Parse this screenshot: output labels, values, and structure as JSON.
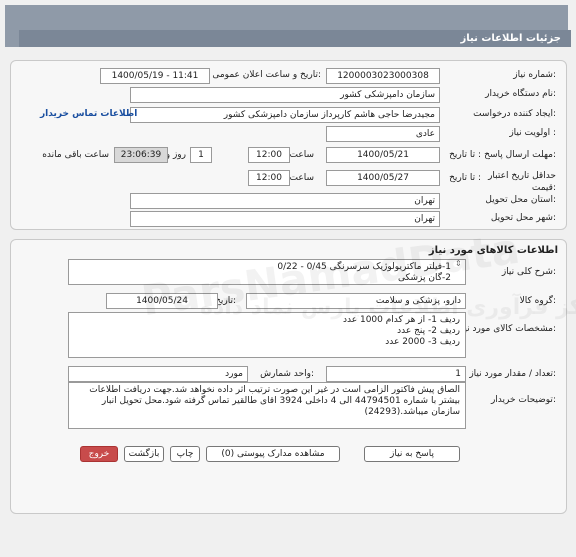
{
  "page_title": "جزئیات اطلاعات نیاز",
  "info": {
    "need_number_label": "شماره نیاز:",
    "need_number": "1200003023000308",
    "announce_label": "تاریخ و ساعت اعلان عمومی:",
    "announce_value": "1400/05/19 - 11:41",
    "buyer_org_label": "نام دستگاه خریدار:",
    "buyer_org": "سازمان دامپزشکی کشور",
    "creator_label": "ایجاد کننده درخواست:",
    "creator": "مجیدرضا حاجی هاشم کارپرداز سازمان دامپزشکی کشور",
    "contact_link": "اطلاعات تماس خریدار",
    "priority_label": "اولویت نیاز :",
    "priority": "عادی",
    "reply_deadline_label": "مهلت ارسال پاسخ:",
    "to_date_label": "تا تاریخ :",
    "reply_date": "1400/05/21",
    "time_label": "ساعت",
    "reply_time": "12:00",
    "days_value": "1",
    "days_label": "روز و",
    "remaining_time": "23:06:39",
    "remaining_label": "ساعت باقی مانده",
    "min_validity_label": "حداقل تاریخ اعتبار قیمت:",
    "validity_to_label": "تا تاریخ :",
    "validity_date": "1400/05/27",
    "validity_time_label": "ساعت",
    "validity_time": "12:00",
    "province_label": "استان محل تحویل:",
    "province": "تهران",
    "city_label": "شهر محل تحویل:",
    "city": "تهران"
  },
  "goods": {
    "section_title": "اطلاعات کالاهای مورد نیاز",
    "summary_label": "شرح کلی نیاز:",
    "summary": "1-فیلتر ماکتریولوژیک سرسرنگی 0/45 - 0/22\n2-گان پزشکی",
    "group_label": "گروه کالا:",
    "group": "دارو، پزشکی و سلامت",
    "need_date_label": "تاریخ نیاز به کالا:",
    "need_date": "1400/05/24",
    "specs_label": "مشخصات کالای مورد نیاز:",
    "specs": "ردیف 1- از هر کدام 1000 عدد\nردیف 2- پنج عدد\nردیف 3- 2000 عدد",
    "qty_label": "تعداد / مقدار مورد نیاز:",
    "qty": "1",
    "unit_label": "واحد شمارش:",
    "unit": "مورد",
    "buyer_notes_label": "توضیحات خریدار:",
    "buyer_notes": "الصاق پیش فاکتور الزامی است در غیر این صورت ترتیب اثر داده نخواهد شد.جهت دریافت اطلاعات بیشتر با شماره 44794501 الی 4 داخلی 3924 اقای طالقیر تماس گرفته شود.محل تحویل انبار سازمان میباشد.(24293)"
  },
  "buttons": {
    "reply": "پاسخ به نیاز",
    "attachments": "مشاهده مدارک پیوستی (0)",
    "print": "چاپ",
    "back": "بازگشت",
    "exit": "خروج"
  },
  "watermark": {
    "text1": "ParsNamadData",
    "text2": "مرکز فرآوری اطلاعات پارس نماد داده"
  }
}
